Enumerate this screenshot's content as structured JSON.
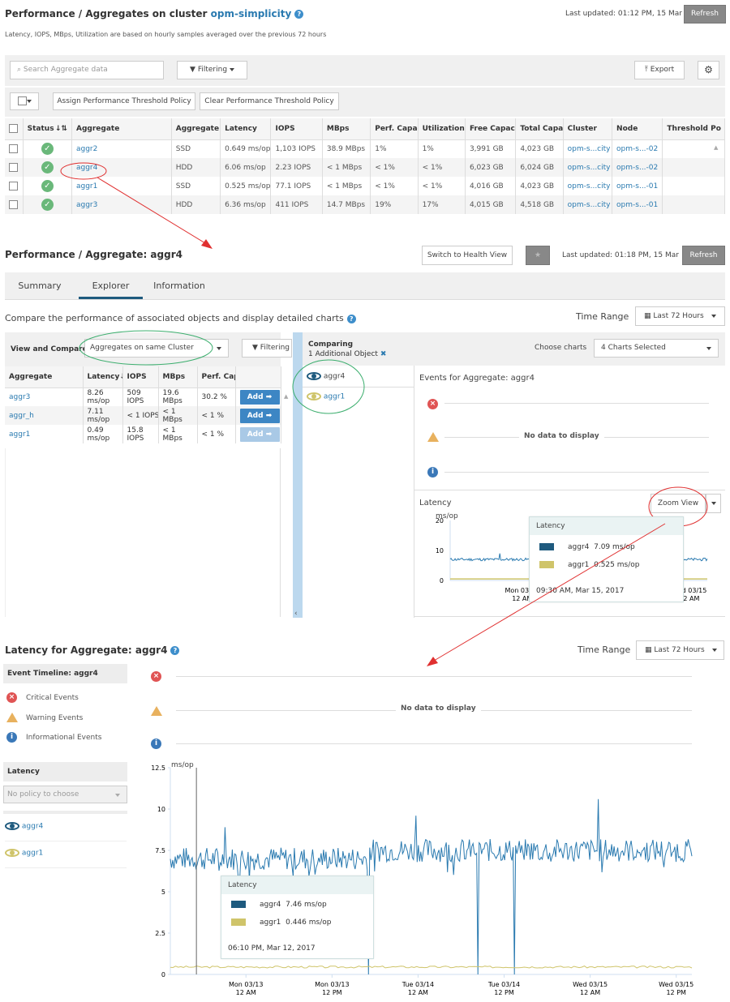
{
  "list_page": {
    "title_prefix": "Performance / Aggregates on cluster ",
    "cluster_link": "opm-simplicity",
    "subtitle": "Latency, IOPS, MBps, Utilization are based on hourly samples averaged over the previous 72 hours",
    "last_updated": "Last updated: 01:12 PM, 15 Mar",
    "refresh_label": "Refresh",
    "search_placeholder": "Search Aggregate data",
    "filtering_label": "Filtering",
    "export_label": "Export",
    "assign_policy_label": "Assign Performance Threshold Policy",
    "clear_policy_label": "Clear Performance Threshold Policy",
    "columns": [
      "Status",
      "Aggregate",
      "Aggregate Ty",
      "Latency",
      "IOPS",
      "MBps",
      "Perf. Capacit",
      "Utilization",
      "Free Capacit",
      "Total Capaci",
      "Cluster",
      "Node",
      "Threshold Po"
    ],
    "rows": [
      {
        "status": "ok",
        "aggregate": "aggr2",
        "type": "SSD",
        "latency": "0.649 ms/op",
        "iops": "1,103 IOPS",
        "mbps": "38.9 MBps",
        "perf_cap": "1%",
        "util": "1%",
        "free": "3,991 GB",
        "total": "4,023 GB",
        "cluster": "opm-s...city",
        "node": "opm-s...-02",
        "policy": ""
      },
      {
        "status": "ok",
        "aggregate": "aggr4",
        "type": "HDD",
        "latency": "6.06 ms/op",
        "iops": "2.23 IOPS",
        "mbps": "< 1 MBps",
        "perf_cap": "< 1%",
        "util": "< 1%",
        "free": "6,023 GB",
        "total": "6,024 GB",
        "cluster": "opm-s...city",
        "node": "opm-s...-02",
        "policy": ""
      },
      {
        "status": "ok",
        "aggregate": "aggr1",
        "type": "SSD",
        "latency": "0.525 ms/op",
        "iops": "77.1 IOPS",
        "mbps": "< 1 MBps",
        "perf_cap": "< 1%",
        "util": "< 1%",
        "free": "4,016 GB",
        "total": "4,023 GB",
        "cluster": "opm-s...city",
        "node": "opm-s...-01",
        "policy": ""
      },
      {
        "status": "ok",
        "aggregate": "aggr3",
        "type": "HDD",
        "latency": "6.36 ms/op",
        "iops": "411 IOPS",
        "mbps": "14.7 MBps",
        "perf_cap": "19%",
        "util": "17%",
        "free": "4,015 GB",
        "total": "4,518 GB",
        "cluster": "opm-s...city",
        "node": "opm-s...-01",
        "policy": ""
      }
    ]
  },
  "detail_page": {
    "title": "Performance / Aggregate: aggr4",
    "switch_label": "Switch to Health View",
    "last_updated": "Last updated: 01:18 PM, 15 Mar",
    "refresh_label": "Refresh",
    "tabs": [
      {
        "label": "Summary"
      },
      {
        "label": "Explorer",
        "active": true
      },
      {
        "label": "Information"
      }
    ],
    "compare_text": "Compare the performance of associated objects and display detailed charts",
    "time_range_label": "Time Range",
    "time_range_value": "Last 72 Hours",
    "view_compare_label": "View and Compare",
    "view_compare_value": "Aggregates on same Cluster",
    "filtering_label": "Filtering",
    "compare_columns": [
      "Aggregate",
      "Latency",
      "IOPS",
      "MBps",
      "Perf. Cap"
    ],
    "compare_rows": [
      {
        "name": "aggr3",
        "latency": [
          "8.26",
          "ms/op"
        ],
        "iops": [
          "509",
          "IOPS"
        ],
        "mbps": [
          "19.6",
          "MBps"
        ],
        "perf": "30.2 %",
        "add": "Add",
        "enabled": true
      },
      {
        "name": "aggr_h",
        "latency": [
          "7.11",
          "ms/op"
        ],
        "iops": [
          "< 1 IOPS",
          ""
        ],
        "mbps": [
          "< 1",
          "MBps"
        ],
        "perf": "< 1 %",
        "add": "Add",
        "enabled": true
      },
      {
        "name": "aggr1",
        "latency": [
          "0.49",
          "ms/op"
        ],
        "iops": [
          "15.8",
          "IOPS"
        ],
        "mbps": [
          "< 1",
          "MBps"
        ],
        "perf": "< 1 %",
        "add": "Add",
        "enabled": false
      }
    ],
    "comparing_label": "Comparing",
    "comparing_count": "1 Additional Object",
    "compared_objects": [
      {
        "name": "aggr4",
        "color": "#1e5a7e"
      },
      {
        "name": "aggr1",
        "color": "#cfc46a"
      }
    ],
    "choose_charts_label": "Choose charts",
    "choose_charts_value": "4 Charts Selected",
    "events_title": "Events for Aggregate: aggr4",
    "no_data": "No data to display",
    "latency_label": "Latency",
    "zoom_view_label": "Zoom View",
    "small_chart": {
      "unit": "ms/op",
      "y_ticks": [
        "20",
        "10",
        "0"
      ],
      "x_ticks": [
        [
          "Mon 03/13",
          "12 AM"
        ],
        [
          "Wed 03/15",
          "12 AM"
        ]
      ],
      "tooltip": {
        "title": "Latency",
        "items": [
          {
            "name": "aggr4",
            "value": "7.09 ms/op",
            "color": "#1e5a7e"
          },
          {
            "name": "aggr1",
            "value": "0.525 ms/op",
            "color": "#cfc46a"
          }
        ],
        "time": "09:30 AM, Mar 15, 2017"
      }
    }
  },
  "zoom_page": {
    "title": "Latency for Aggregate: aggr4",
    "time_range_label": "Time Range",
    "time_range_value": "Last 72 Hours",
    "event_timeline_title": "Event Timeline: aggr4",
    "event_types": [
      "Critical Events",
      "Warning Events",
      "Informational Events"
    ],
    "latency_section": "Latency",
    "policy_placeholder": "No policy to choose",
    "objects": [
      {
        "name": "aggr4",
        "color": "#1e5a7e"
      },
      {
        "name": "aggr1",
        "color": "#cfc46a"
      }
    ],
    "no_data": "No data to display"
  },
  "chart_data": {
    "type": "line",
    "title": "Latency for Aggregate: aggr4",
    "ylabel": "ms/op",
    "ylim": [
      0,
      12.5
    ],
    "y_ticks": [
      "12.5",
      "10",
      "7.5",
      "5",
      "2.5",
      "0"
    ],
    "x_ticks": [
      [
        "Mon 03/13",
        "12 AM"
      ],
      [
        "Mon 03/13",
        "12 PM"
      ],
      [
        "Tue 03/14",
        "12 AM"
      ],
      [
        "Tue 03/14",
        "12 PM"
      ],
      [
        "Wed 03/15",
        "12 AM"
      ],
      [
        "Wed 03/15",
        "12 PM"
      ]
    ],
    "series": [
      {
        "name": "aggr4",
        "color": "#2a7ab0",
        "baseline_segments": [
          {
            "from": 0,
            "to": 0.38,
            "mean": 7.0
          },
          {
            "from": 0.38,
            "to": 1.0,
            "mean": 7.5
          }
        ],
        "spikes": [
          {
            "t": 0.105,
            "v": 8.9
          },
          {
            "t": 0.47,
            "v": 9.6
          },
          {
            "t": 0.38,
            "v": 0
          },
          {
            "t": 0.59,
            "v": 0
          },
          {
            "t": 0.66,
            "v": 0
          },
          {
            "t": 0.82,
            "v": 10.6
          }
        ]
      },
      {
        "name": "aggr1",
        "color": "#cfc46a",
        "mean": 0.45
      }
    ],
    "tooltip": {
      "title": "Latency",
      "items": [
        {
          "name": "aggr4",
          "value": "7.46 ms/op",
          "color": "#1e5a7e"
        },
        {
          "name": "aggr1",
          "value": "0.446 ms/op",
          "color": "#cfc46a"
        }
      ],
      "time": "06:10 PM, Mar 12, 2017"
    }
  }
}
